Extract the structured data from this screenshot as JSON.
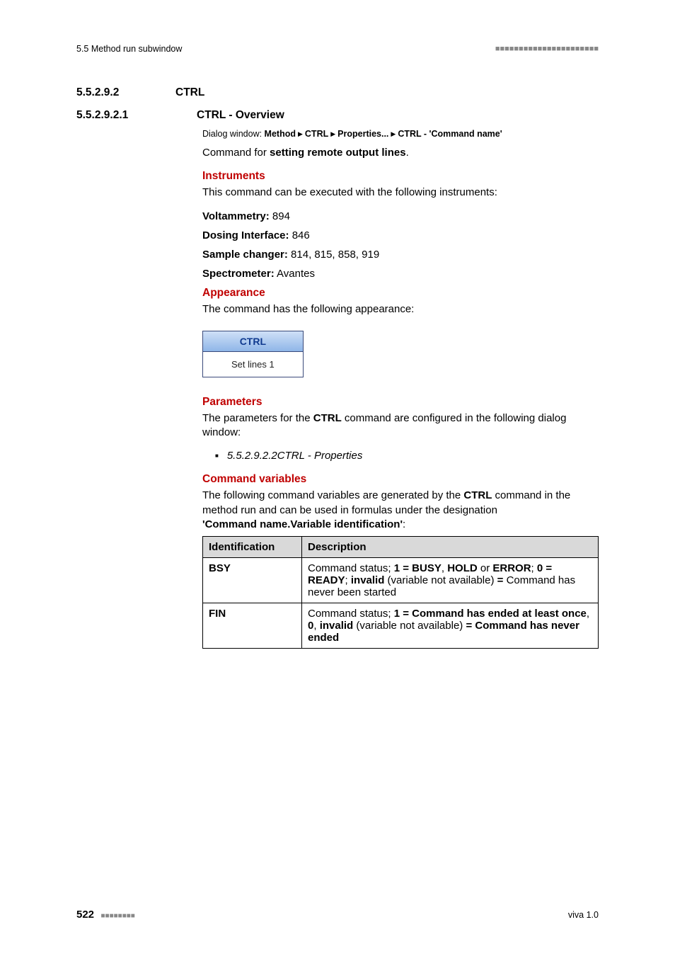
{
  "header": {
    "left": "5.5 Method run subwindow",
    "squares": "■■■■■■■■■■■■■■■■■■■■■■"
  },
  "section1": {
    "num": "5.5.2.9.2",
    "title": "CTRL"
  },
  "section2": {
    "num": "5.5.2.9.2.1",
    "title": "CTRL - Overview"
  },
  "dialog": {
    "prefix": "Dialog window: ",
    "p1": "Method",
    "p2": "CTRL",
    "p3": "Properties...",
    "p4": "CTRL - 'Command name'"
  },
  "intro": {
    "pre": "Command for ",
    "bold": "setting remote output lines",
    "post": "."
  },
  "instruments": {
    "heading": "Instruments",
    "line": "This command can be executed with the following instruments:",
    "rows": [
      {
        "label": "Voltammetry:",
        "val": " 894"
      },
      {
        "label": "Dosing Interface:",
        "val": " 846"
      },
      {
        "label": "Sample changer:",
        "val": " 814, 815, 858, 919"
      },
      {
        "label": "Spectrometer:",
        "val": " Avantes"
      }
    ]
  },
  "appearance": {
    "heading": "Appearance",
    "text": "The command has the following appearance:",
    "box_title": "CTRL",
    "box_body": "Set lines 1"
  },
  "parameters": {
    "heading": "Parameters",
    "text_pre": "The parameters for the ",
    "text_bold": "CTRL",
    "text_post": " command are configured in the following dialog window:",
    "bullet": "5.5.2.9.2.2CTRL - Properties"
  },
  "cmdvars": {
    "heading": "Command variables",
    "text_pre": "The following command variables are generated by the ",
    "text_bold": "CTRL",
    "text_mid": " command in the method run and can be used in formulas under the designation ",
    "text_last_bold": "'Command name.Variable identification'",
    "text_colon": ":",
    "th1": "Identification",
    "th2": "Description",
    "rows": [
      {
        "id": "BSY",
        "desc_parts": {
          "a": "Command status; ",
          "b": "1 = BUSY",
          "c": ", ",
          "d": "HOLD",
          "e": " or ",
          "f": "ERROR",
          "g": "; ",
          "h": "0 = READY",
          "i": "; ",
          "j": "invalid",
          "k": " (variable not available) ",
          "l": "=",
          "m": " Command has never been started"
        }
      },
      {
        "id": "FIN",
        "desc_parts": {
          "a": "Command status; ",
          "b": "1 = Command has ended at least once",
          "c": ", ",
          "d": "0",
          "e": ", ",
          "f": "invalid",
          "g": " (variable not available) ",
          "h": "= Command has never ended"
        }
      }
    ]
  },
  "footer": {
    "page": "522",
    "squares": "■■■■■■■■",
    "right": "viva 1.0"
  }
}
